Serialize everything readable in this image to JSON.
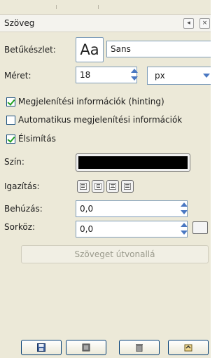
{
  "panel": {
    "title": "Szöveg"
  },
  "font": {
    "label": "Betűkészlet:",
    "preview": "Aa",
    "value": "Sans"
  },
  "size": {
    "label": "Méret:",
    "value": "18",
    "unit": "px"
  },
  "checks": [
    {
      "label": "Megjelenítési információk (hinting)",
      "checked": true
    },
    {
      "label": "Automatikus megjelenítési információk",
      "checked": false
    },
    {
      "label": "Élsimítás",
      "checked": true
    }
  ],
  "color": {
    "label": "Szín:",
    "value": "#000000"
  },
  "justify": {
    "label": "Igazítás:",
    "options": [
      "left",
      "right",
      "center",
      "fill"
    ]
  },
  "indent": {
    "label": "Behúzás:",
    "value": "0,0"
  },
  "linespacing": {
    "label": "Sorköz:",
    "value": "0,0"
  },
  "path_button": {
    "label": "Szöveget útvonallá"
  },
  "bottom_buttons": [
    {
      "icon": "save-icon"
    },
    {
      "icon": "restore-icon"
    },
    {
      "icon": "delete-icon"
    },
    {
      "icon": "reset-icon"
    }
  ],
  "colors": {
    "panel_bg": "#ece9d8",
    "border_blue": "#7f9db9",
    "spin_blue": "#4a78c2",
    "check_green": "#21a121"
  }
}
